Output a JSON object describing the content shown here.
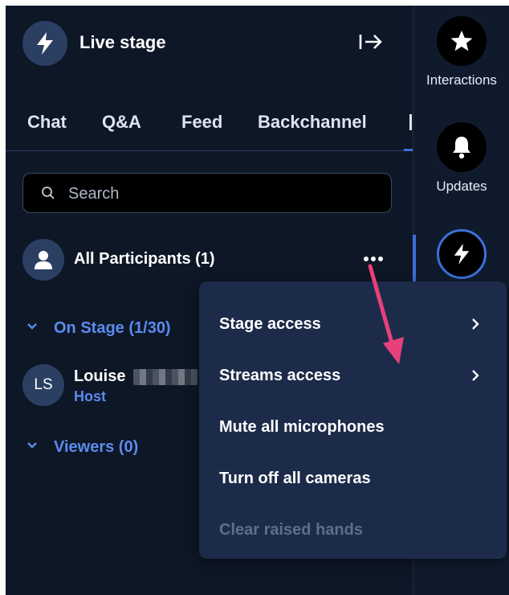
{
  "header": {
    "title": "Live stage",
    "logo_icon": "lightning-icon",
    "exit_icon": "exit-panel-icon"
  },
  "tabs": [
    {
      "label": "Chat"
    },
    {
      "label": "Q&A"
    },
    {
      "label": "Feed"
    },
    {
      "label": "Backchannel"
    }
  ],
  "search": {
    "placeholder": "Search",
    "value": ""
  },
  "participants": {
    "label": "All Participants (1)",
    "more_icon": "more-horizontal-icon",
    "groups": [
      {
        "label": "On Stage (1/30)"
      },
      {
        "label": "Viewers (0)"
      }
    ],
    "members": [
      {
        "initials": "LS",
        "name": "Louise",
        "role": "Host"
      }
    ]
  },
  "menu": {
    "items": [
      {
        "label": "Stage access",
        "has_submenu": true,
        "disabled": false
      },
      {
        "label": "Streams access",
        "has_submenu": true,
        "disabled": false
      },
      {
        "label": "Mute all microphones",
        "has_submenu": false,
        "disabled": false
      },
      {
        "label": "Turn off all cameras",
        "has_submenu": false,
        "disabled": false
      },
      {
        "label": "Clear raised hands",
        "has_submenu": false,
        "disabled": true
      }
    ]
  },
  "rail": {
    "items": [
      {
        "label": "Interactions",
        "icon": "star-icon"
      },
      {
        "label": "Updates",
        "icon": "bell-icon"
      },
      {
        "label": "",
        "icon": "lightning-icon",
        "active": true
      }
    ]
  },
  "colors": {
    "background": "#0d1726",
    "accent": "#3d6fd8",
    "group_blue": "#5b8bee",
    "menu_bg": "#1d2b4a",
    "annotation_arrow": "#e8407a"
  }
}
